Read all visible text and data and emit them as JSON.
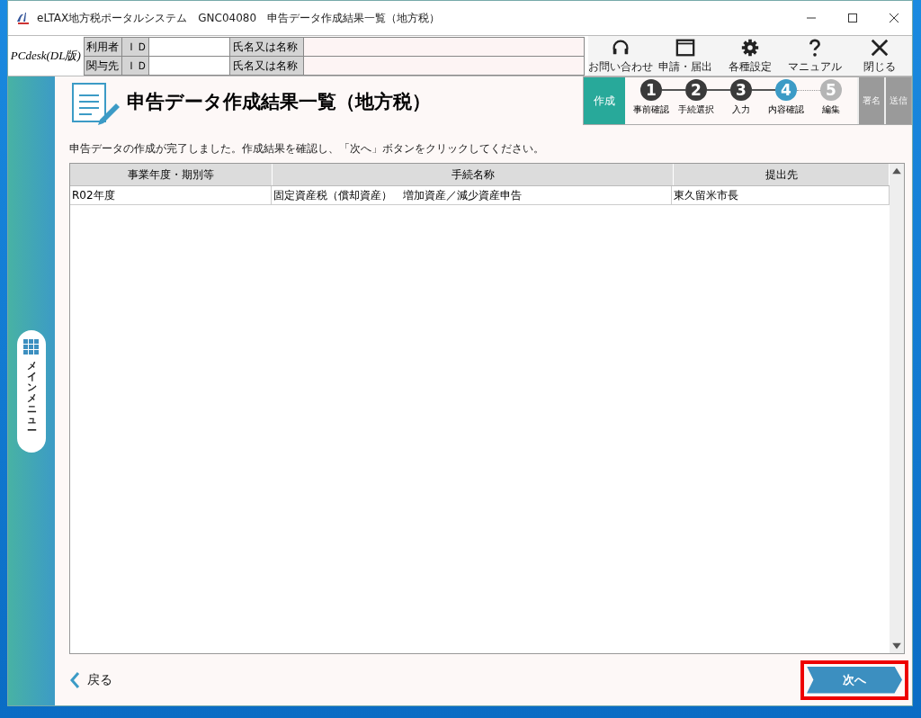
{
  "window": {
    "title": "eLTAX地方税ポータルシステム　GNC04080　申告データ作成結果一覧（地方税）"
  },
  "header": {
    "logo": "PCdesk(DL版)",
    "rows": [
      {
        "role": "利用者",
        "id_label": "ＩＤ",
        "name_label": "氏名又は名称"
      },
      {
        "role": "関与先",
        "id_label": "ＩＤ",
        "name_label": "氏名又は名称"
      }
    ],
    "tools": [
      {
        "kind": "headset",
        "label": "お問い合わせ"
      },
      {
        "kind": "window",
        "label": "申請・届出"
      },
      {
        "kind": "gear",
        "label": "各種設定"
      },
      {
        "kind": "help",
        "label": "マニュアル"
      },
      {
        "kind": "close",
        "label": "閉じる"
      }
    ]
  },
  "sidebar": {
    "label": "メインメニュー"
  },
  "page": {
    "title": "申告データ作成結果一覧（地方税）",
    "steps": {
      "phase": "作成",
      "items": [
        {
          "number": "1",
          "label": "事前確認",
          "completed": true,
          "selected": false
        },
        {
          "number": "2",
          "label": "手続選択",
          "completed": true,
          "selected": false
        },
        {
          "number": "3",
          "label": "入力",
          "completed": true,
          "selected": false
        },
        {
          "number": "4",
          "label": "内容確認",
          "completed": false,
          "selected": true
        },
        {
          "number": "5",
          "label": "編集",
          "completed": false,
          "selected": false
        }
      ],
      "after": [
        {
          "label": "署名",
          "disabled": true
        },
        {
          "label": "送信",
          "disabled": true
        }
      ]
    },
    "message": "申告データの作成が完了しました。作成結果を確認し、「次へ」ボタンをクリックしてください。",
    "table": {
      "columns": [
        "事業年度・期別等",
        "手続名称",
        "提出先"
      ],
      "rows": [
        [
          "R02年度",
          "固定資産税（償却資産）　増加資産／減少資産申告",
          "東久留米市長"
        ]
      ]
    },
    "back": "戻る",
    "next": "次へ"
  }
}
